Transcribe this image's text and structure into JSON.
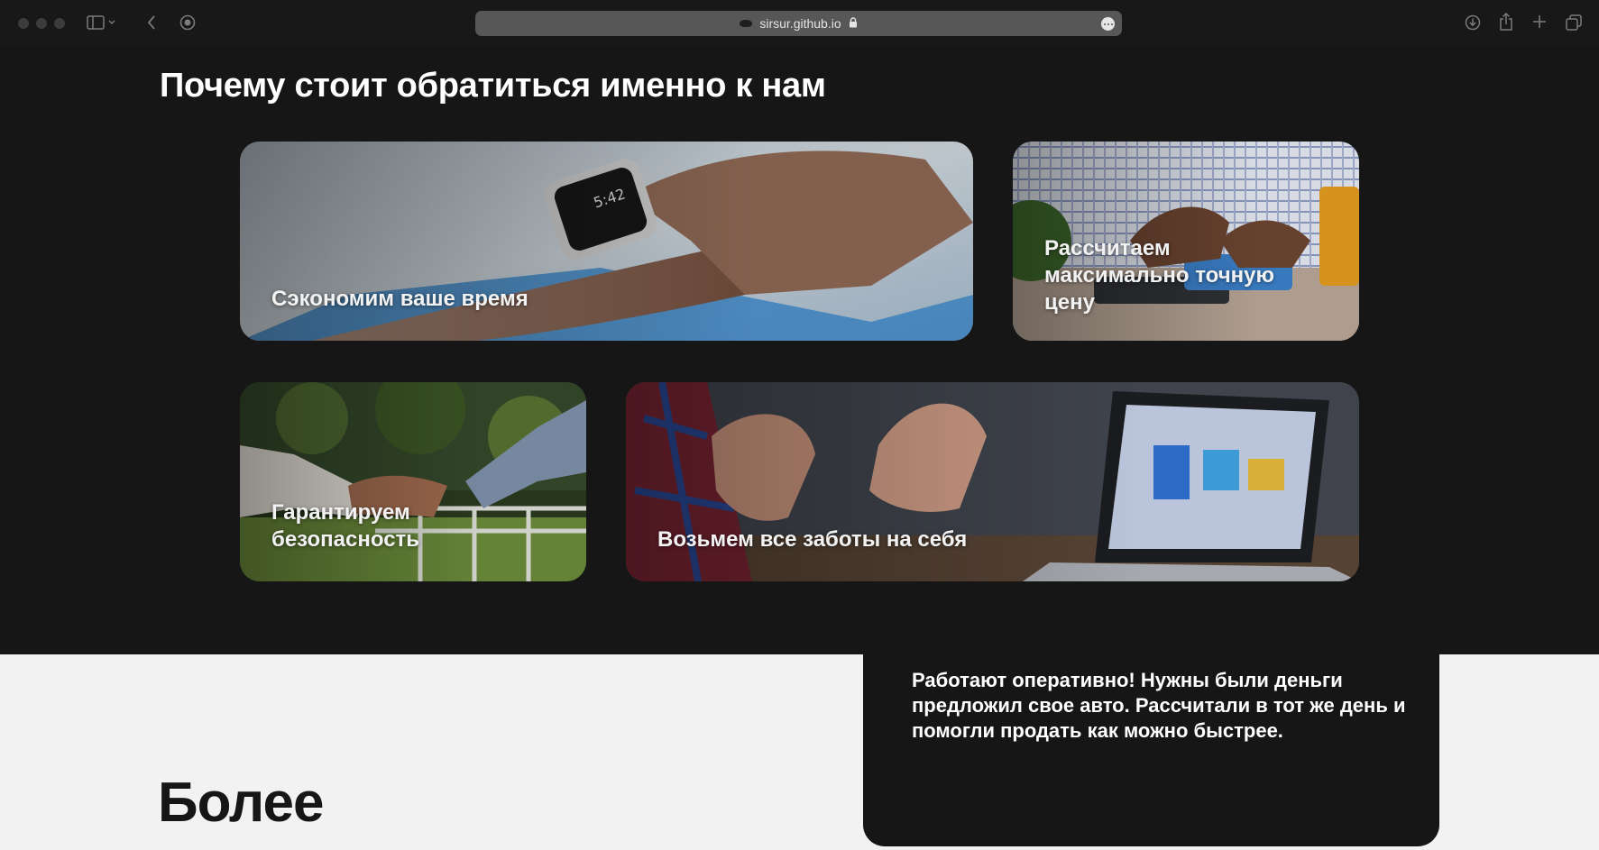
{
  "browser": {
    "url": "sirsur.github.io"
  },
  "page": {
    "section_title": "Почему стоит обратиться именно к нам",
    "cards": [
      {
        "label": "Сэкономим ваше время"
      },
      {
        "label": "Рассчитаем максимально точную цену"
      },
      {
        "label": "Гарантируем безопасность"
      },
      {
        "label": "Возьмем все заботы на себя"
      }
    ],
    "more_heading": "Более",
    "review_text": "Работают оперативно! Нужны были деньги предложил свое авто. Рассчитали в тот же день и помогли продать как можно быстрее."
  },
  "icons": {
    "sidebar": "sidebar-icon",
    "back": "chevron-left-icon",
    "privacy": "privacy-report-icon",
    "download": "download-icon",
    "share": "share-icon",
    "new_tab": "plus-icon",
    "tabs": "tab-overview-icon",
    "lock": "lock-icon",
    "more": "more-icon"
  },
  "colors": {
    "dark_bg": "#161616",
    "light_bg": "#f2f2f2",
    "text_light": "#ffffff"
  }
}
